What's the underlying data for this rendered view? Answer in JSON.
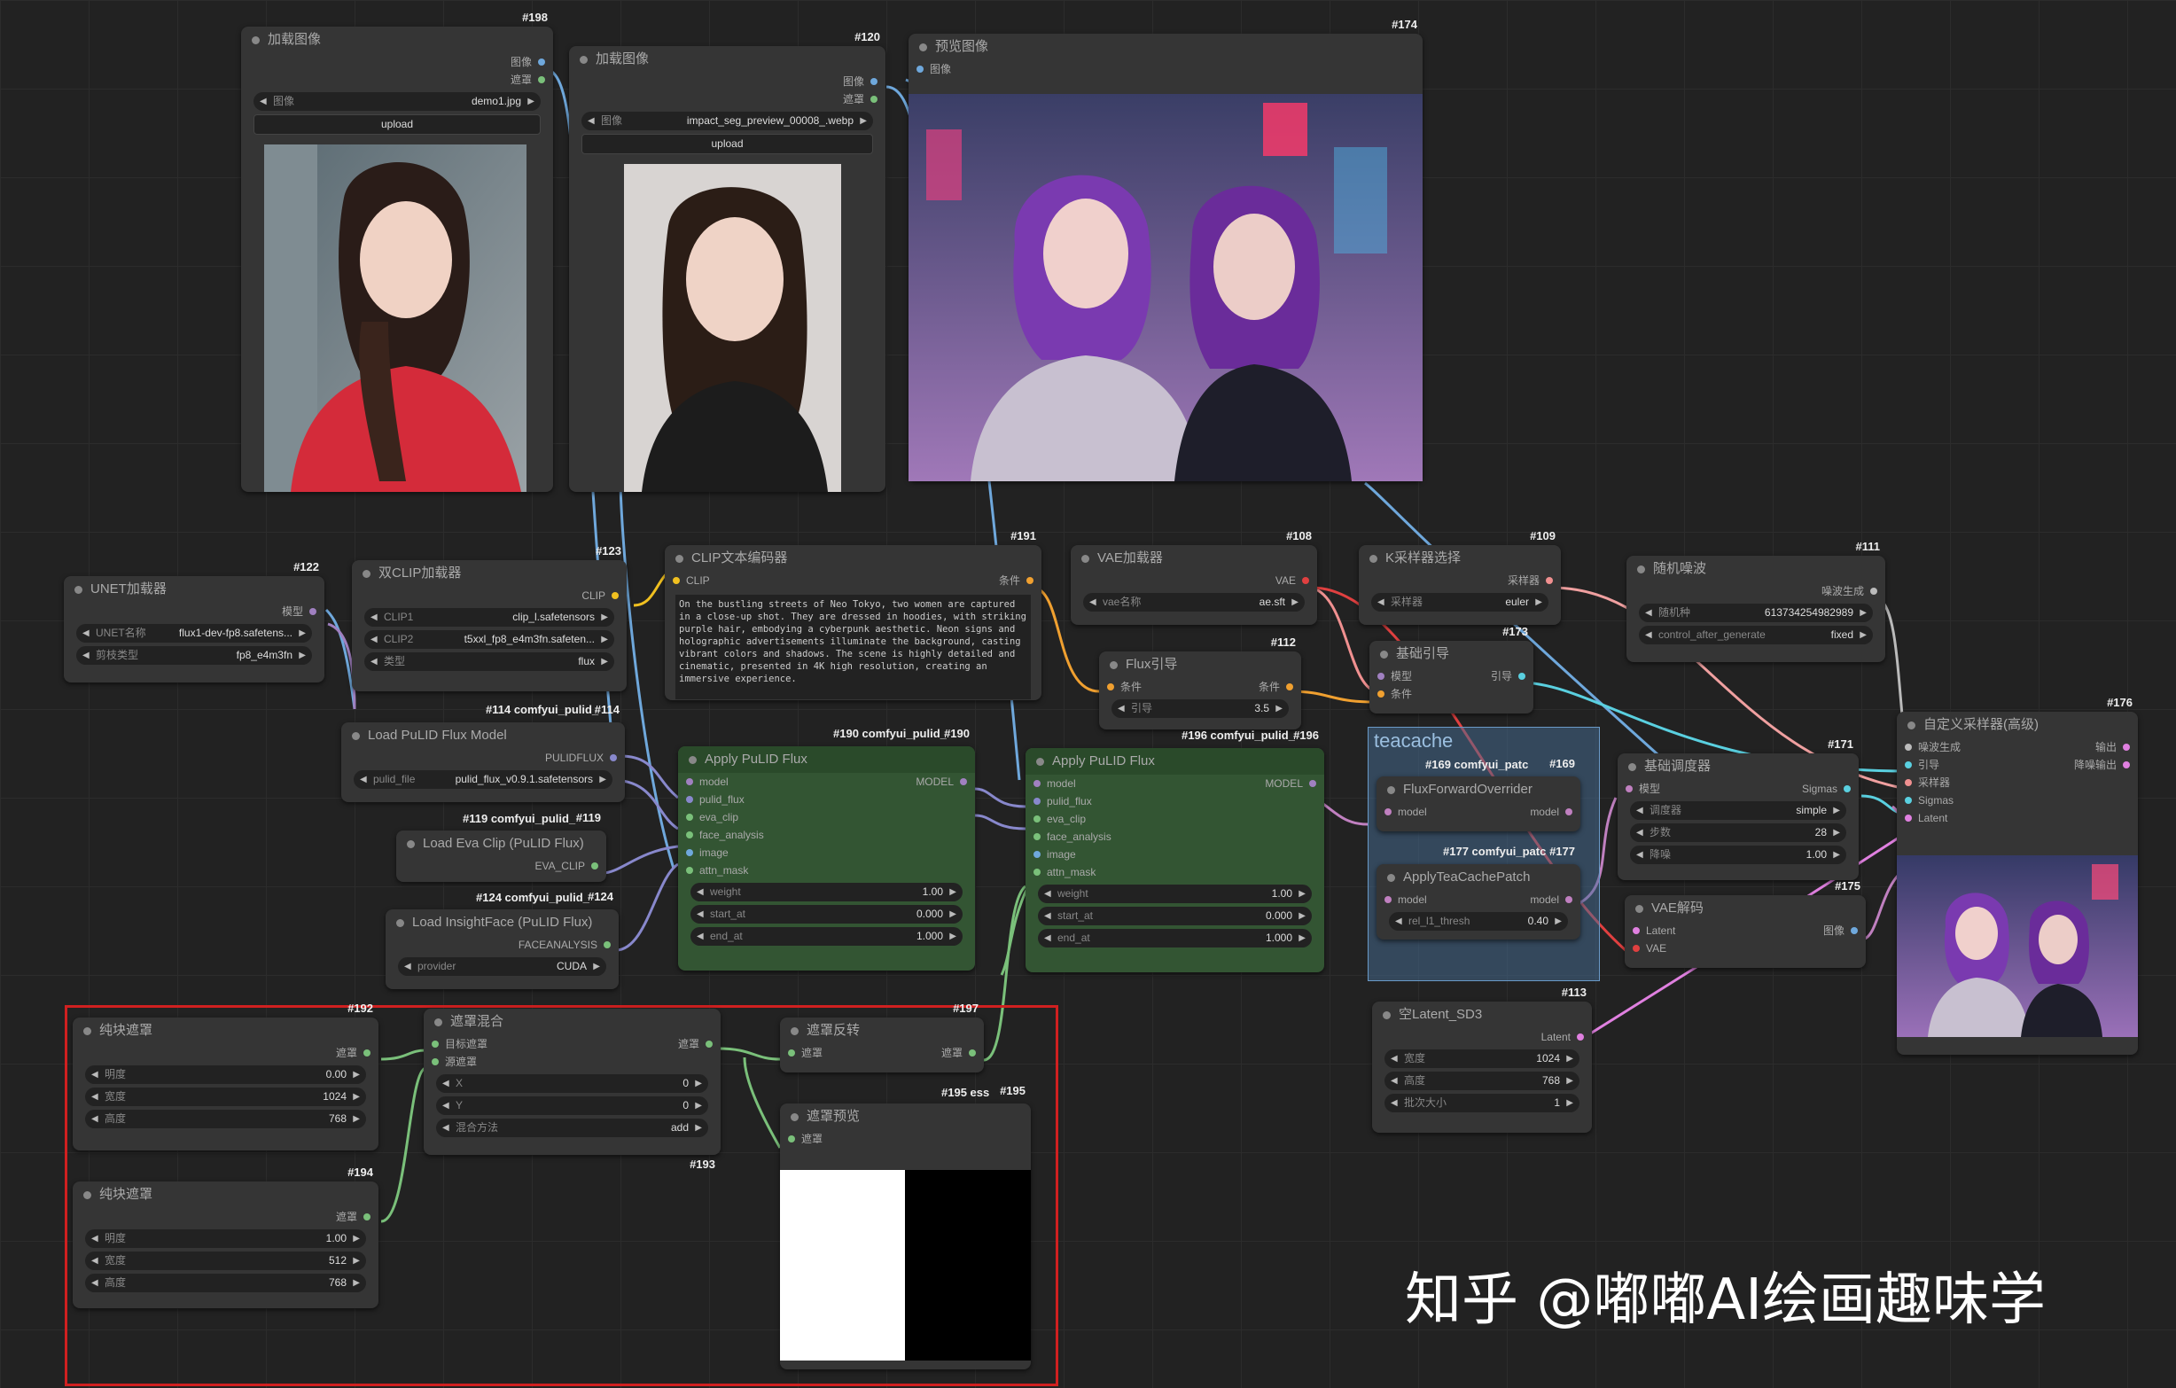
{
  "watermark": "知乎 @嘟嘟AI绘画趣味学",
  "nodes": {
    "n198": {
      "id": "#198",
      "title": "加载图像",
      "out_image": "图像",
      "out_mask": "遮罩",
      "w_label": "图像",
      "w_value": "demo1.jpg",
      "upload": "upload"
    },
    "n120": {
      "id": "#120",
      "title": "加载图像",
      "out_image": "图像",
      "out_mask": "遮罩",
      "w_label": "图像",
      "w_value": "impact_seg_preview_00008_.webp",
      "upload": "upload"
    },
    "n174": {
      "id": "#174",
      "title": "预览图像",
      "in_image": "图像"
    },
    "n122": {
      "id": "#122",
      "title": "UNET加载器",
      "out_model": "模型",
      "w1_label": "UNET名称",
      "w1_value": "flux1-dev-fp8.safetens...",
      "w2_label": "剪枝类型",
      "w2_value": "fp8_e4m3fn"
    },
    "n123": {
      "id": "#123",
      "title": "双CLIP加载器",
      "out_clip": "CLIP",
      "w1_label": "CLIP1",
      "w1_value": "clip_l.safetensors",
      "w2_label": "CLIP2",
      "w2_value": "t5xxl_fp8_e4m3fn.safeten...",
      "w3_label": "类型",
      "w3_value": "flux"
    },
    "n191": {
      "id": "#191",
      "title": "CLIP文本编码器",
      "in_clip": "CLIP",
      "out_cond": "条件",
      "text": "On the bustling streets of Neo Tokyo, two women are captured in a close-up shot. They are dressed in hoodies, with striking purple hair, embodying a cyberpunk aesthetic. Neon signs and holographic advertisements illuminate the background, casting vibrant colors and shadows. The scene is highly detailed and cinematic, presented in 4K high resolution, creating an immersive experience."
    },
    "n108": {
      "id": "#108",
      "title": "VAE加载器",
      "out_vae": "VAE",
      "w_label": "vae名称",
      "w_value": "ae.sft"
    },
    "n112": {
      "id": "#112",
      "title": "Flux引导",
      "in_cond": "条件",
      "out_cond": "条件",
      "w_label": "引导",
      "w_value": "3.5"
    },
    "n109": {
      "id": "#109",
      "title": "K采样器选择",
      "out_sampler": "采样器",
      "w_label": "采样器",
      "w_value": "euler"
    },
    "n173": {
      "id": "#173",
      "title": "基础引导",
      "in_model": "模型",
      "in_cond": "条件",
      "out_guide": "引导"
    },
    "n111": {
      "id": "#111",
      "title": "随机噪波",
      "out_noise": "噪波生成",
      "w1_label": "随机种",
      "w1_value": "613734254982989",
      "w2_label": "control_after_generate",
      "w2_value": "fixed"
    },
    "n114": {
      "id": "#114",
      "subtitle": "#114 comfyui_pulid_",
      "title": "Load PuLID Flux Model",
      "out": "PULIDFLUX",
      "w_label": "pulid_file",
      "w_value": "pulid_flux_v0.9.1.safetensors"
    },
    "n119": {
      "id": "#119",
      "subtitle": "#119 comfyui_pulid_",
      "title": "Load Eva Clip (PuLID Flux)",
      "out": "EVA_CLIP"
    },
    "n124": {
      "id": "#124",
      "subtitle": "#124 comfyui_pulid_",
      "title": "Load InsightFace (PuLID Flux)",
      "out": "FACEANALYSIS",
      "w_label": "provider",
      "w_value": "CUDA"
    },
    "n190": {
      "id": "#190",
      "subtitle": "#190 comfyui_pulid_",
      "title": "Apply PuLID Flux",
      "inputs": [
        "model",
        "pulid_flux",
        "eva_clip",
        "face_analysis",
        "image",
        "attn_mask"
      ],
      "out": "MODEL",
      "weight_label": "weight",
      "weight": "1.00",
      "start_label": "start_at",
      "start": "0.000",
      "end_label": "end_at",
      "end": "1.000"
    },
    "n196": {
      "id": "#196",
      "subtitle": "#196 comfyui_pulid_",
      "title": "Apply PuLID Flux",
      "inputs": [
        "model",
        "pulid_flux",
        "eva_clip",
        "face_analysis",
        "image",
        "attn_mask"
      ],
      "out": "MODEL",
      "weight_label": "weight",
      "weight": "1.00",
      "start_label": "start_at",
      "start": "0.000",
      "end_label": "end_at",
      "end": "1.000"
    },
    "tea": {
      "label": "teacache"
    },
    "n169": {
      "id": "#169",
      "subtitle": "#169 comfyui_patc",
      "title": "FluxForwardOverrider",
      "in": "model",
      "out": "model"
    },
    "n177": {
      "id": "#177",
      "subtitle": "#177 comfyui_patc",
      "title": "ApplyTeaCachePatch",
      "in": "model",
      "out": "model",
      "w_label": "rel_l1_thresh",
      "w_value": "0.40"
    },
    "n171": {
      "id": "#171",
      "title": "基础调度器",
      "in_model": "模型",
      "out": "Sigmas",
      "w1_label": "调度器",
      "w1_value": "simple",
      "w2_label": "步数",
      "w2_value": "28",
      "w3_label": "降噪",
      "w3_value": "1.00"
    },
    "n175": {
      "id": "#175",
      "title": "VAE解码",
      "in1": "Latent",
      "in2": "VAE",
      "out": "图像"
    },
    "n113": {
      "id": "#113",
      "title": "空Latent_SD3",
      "out": "Latent",
      "w1_label": "宽度",
      "w1_value": "1024",
      "w2_label": "高度",
      "w2_value": "768",
      "w3_label": "批次大小",
      "w3_value": "1"
    },
    "n176": {
      "id": "#176",
      "title": "自定义采样器(高级)",
      "inputs": [
        "噪波生成",
        "引导",
        "采样器",
        "Sigmas",
        "Latent"
      ],
      "out1": "输出",
      "out2": "降噪输出"
    },
    "n192": {
      "id": "#192",
      "title": "纯块遮罩",
      "out": "遮罩",
      "w1_label": "明度",
      "w1_value": "0.00",
      "w2_label": "宽度",
      "w2_value": "1024",
      "w3_label": "高度",
      "w3_value": "768"
    },
    "n194": {
      "id": "#194",
      "title": "纯块遮罩",
      "out": "遮罩",
      "w1_label": "明度",
      "w1_value": "1.00",
      "w2_label": "宽度",
      "w2_value": "512",
      "w3_label": "高度",
      "w3_value": "768"
    },
    "n193": {
      "id": "#193",
      "title": "遮罩混合",
      "in1": "目标遮罩",
      "in2": "源遮罩",
      "out": "遮罩",
      "w1_label": "X",
      "w1_value": "0",
      "w2_label": "Y",
      "w2_value": "0",
      "w3_label": "混合方法",
      "w3_value": "add"
    },
    "n197": {
      "id": "#197",
      "title": "遮罩反转",
      "in": "遮罩",
      "out": "遮罩"
    },
    "n195": {
      "id": "#195",
      "subtitle": "#195 ess",
      "title": "遮罩预览",
      "in": "遮罩"
    }
  }
}
